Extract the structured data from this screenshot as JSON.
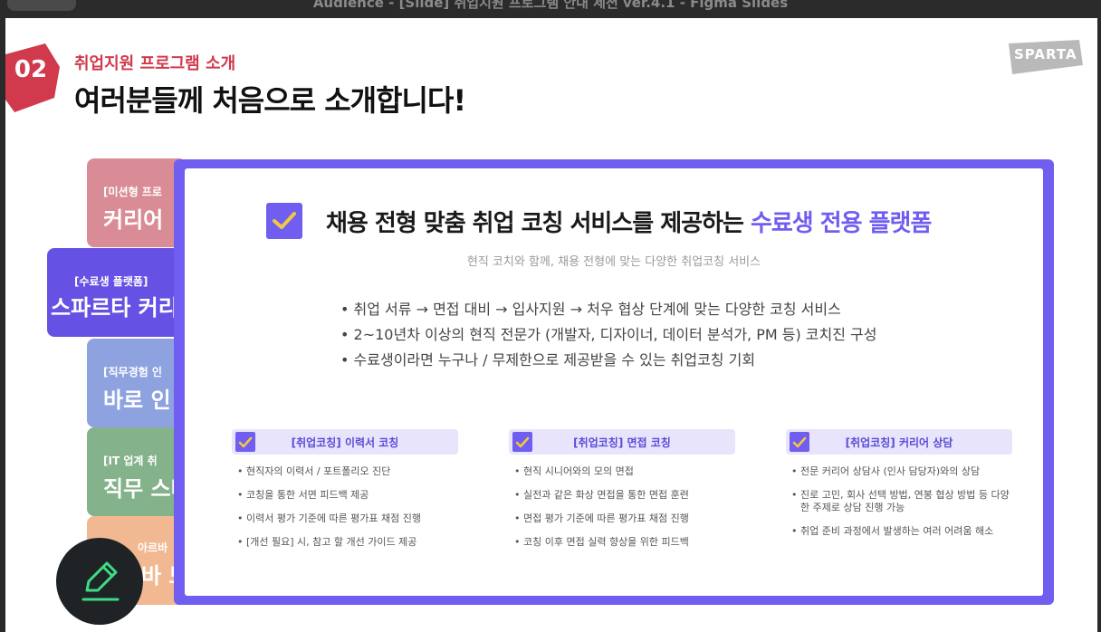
{
  "window": {
    "title": "Audience - [Slide] 취업지원 프로그램 안내 세션 ver.4.1 - Figma Slides"
  },
  "slide": {
    "section_number": "02",
    "section_label": "취업지원 프로그램 소개",
    "heading": "여러분들께 처음으로 소개합니다!",
    "logo_text": "SPARTA"
  },
  "side_tabs": [
    {
      "tag": "[미션형 프로",
      "name": "커리어"
    },
    {
      "tag": "[수료생 플랫폼]",
      "name": "스파르타 커리어"
    },
    {
      "tag": "[직무경험 인",
      "name": "바로 인"
    },
    {
      "tag": "[IT 업계 취",
      "name": "직무 스타"
    },
    {
      "tag": "아르바",
      "name": "바 모"
    }
  ],
  "card": {
    "title_main": "채용 전형 맞춤 취업 코칭 서비스를 제공하는 ",
    "title_highlight": "수료생 전용 플랫폼",
    "subtitle": "현직 코치와 함께, 채용 전형에 맞는 다양한 취업코칭 서비스",
    "bullets": [
      "취업 서류 → 면접 대비 → 입사지원 → 처우 협상 단계에 맞는 다양한 코칭 서비스",
      "2~10년차 이상의 현직 전문가 (개발자, 디자이너, 데이터 분석가, PM 등) 코치진 구성",
      "수료생이라면 누구나 / 무제한으로 제공받을 수 있는 취업코칭 기회"
    ],
    "columns": [
      {
        "label": "[취업코칭] 이력서 코칭",
        "items": [
          "현직자의 이력서 / 포트폴리오 진단",
          "코칭을 통한 서면 피드백 제공",
          "이력서 평가 기준에 따른 평가표 채점 진행",
          "[개선 필요] 시, 참고 할 개선 가이드 제공"
        ]
      },
      {
        "label": "[취업코칭] 면접 코칭",
        "items": [
          "현직 시니어와의 모의 면접",
          "실전과 같은 화상 면접을 통한 면접 훈련",
          "면접 평가 기준에 따른 평가표 채점 진행",
          "코칭 이후 면접 실력 향상을 위한 피드백"
        ]
      },
      {
        "label": "[취업코칭]  커리어 상담",
        "items": [
          "전문 커리어 상담사 (인사 담당자)와의 상담",
          "진로 고민, 회사 선택 방법, 연봉 협상 방법 등 다양한 주제로 상담 진행 가능",
          "취업 준비 과정에서 발생하는 여러 어려움 해소"
        ]
      }
    ]
  },
  "colors": {
    "accent": "#6f5ef0",
    "section_red": "#d03a4c",
    "chip_bg": "#e7e4fb",
    "fab_icon": "#3ddc84"
  },
  "icons": {
    "check": "checkmark-icon",
    "fab": "pencil-icon"
  }
}
